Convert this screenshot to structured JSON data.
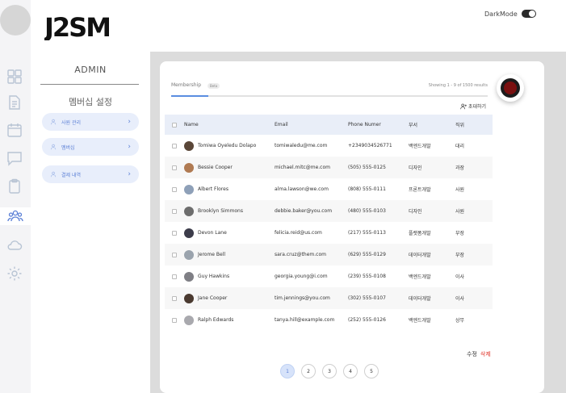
{
  "header": {
    "logo_text": "J2SM",
    "darkmode_label": "DarkMode",
    "darkmode_on": true
  },
  "rail": {
    "icons": [
      "grid-icon",
      "document-icon",
      "calendar-icon",
      "chat-icon",
      "clipboard-icon",
      "users-icon",
      "cloud-icon",
      "settings-icon"
    ],
    "active": "users-icon"
  },
  "admin": {
    "title": "ADMIN",
    "section_title": "멤버십 설정",
    "menu": [
      {
        "label": "사원 관리",
        "icon": "user-icon"
      },
      {
        "label": "멤버십",
        "icon": "user-icon"
      },
      {
        "label": "결제 내역",
        "icon": "user-icon"
      }
    ]
  },
  "membership": {
    "tab_label": "Membership",
    "tab_badge": "Beta",
    "showing": "Showing 1 - 9 of 1500 results",
    "invite_label": "초대하기"
  },
  "table": {
    "columns": [
      "Name",
      "Email",
      "Phone Numer",
      "부서",
      "직위"
    ],
    "rows": [
      {
        "name": "Tomiwa Oyeledu Dolapo",
        "email": "tomiwaledu@me.com",
        "phone": "+2349034526771",
        "dept": "백엔드개발",
        "title": "대리",
        "avatar": "#5a4638"
      },
      {
        "name": "Bessie Cooper",
        "email": "michael.mitc@me.com",
        "phone": "(505) 555-0125",
        "dept": "디자인",
        "title": "과장",
        "avatar": "#b07a52"
      },
      {
        "name": "Albert Flores",
        "email": "alma.lawson@we.com",
        "phone": "(808) 555-0111",
        "dept": "프론트개발",
        "title": "사원",
        "avatar": "#8ea0b8"
      },
      {
        "name": "Brooklyn Simmons",
        "email": "debbie.baker@you.com",
        "phone": "(480) 555-0103",
        "dept": "디자인",
        "title": "사원",
        "avatar": "#6d6d6d"
      },
      {
        "name": "Devon Lane",
        "email": "felicia.reid@us.com",
        "phone": "(217) 555-0113",
        "dept": "플랫폼개발",
        "title": "부장",
        "avatar": "#3c3c4a"
      },
      {
        "name": "Jerome Bell",
        "email": "sara.cruz@them.com",
        "phone": "(629) 555-0129",
        "dept": "데이터개발",
        "title": "부장",
        "avatar": "#9aa3ad"
      },
      {
        "name": "Guy Hawkins",
        "email": "georgia.young@i.com",
        "phone": "(239) 555-0108",
        "dept": "백엔드개발",
        "title": "이사",
        "avatar": "#7f7f85"
      },
      {
        "name": "Jane Cooper",
        "email": "tim.jennings@you.com",
        "phone": "(302) 555-0107",
        "dept": "데이터개발",
        "title": "이사",
        "avatar": "#4a3a30"
      },
      {
        "name": "Ralph Edwards",
        "email": "tanya.hill@example.com",
        "phone": "(252) 555-0126",
        "dept": "백엔드개발",
        "title": "상무",
        "avatar": "#a9a9ae"
      }
    ]
  },
  "actions": {
    "edit_label": "수정",
    "delete_label": "삭제"
  },
  "pagination": {
    "pages": [
      "1",
      "2",
      "3",
      "4",
      "5"
    ],
    "current": "1"
  }
}
